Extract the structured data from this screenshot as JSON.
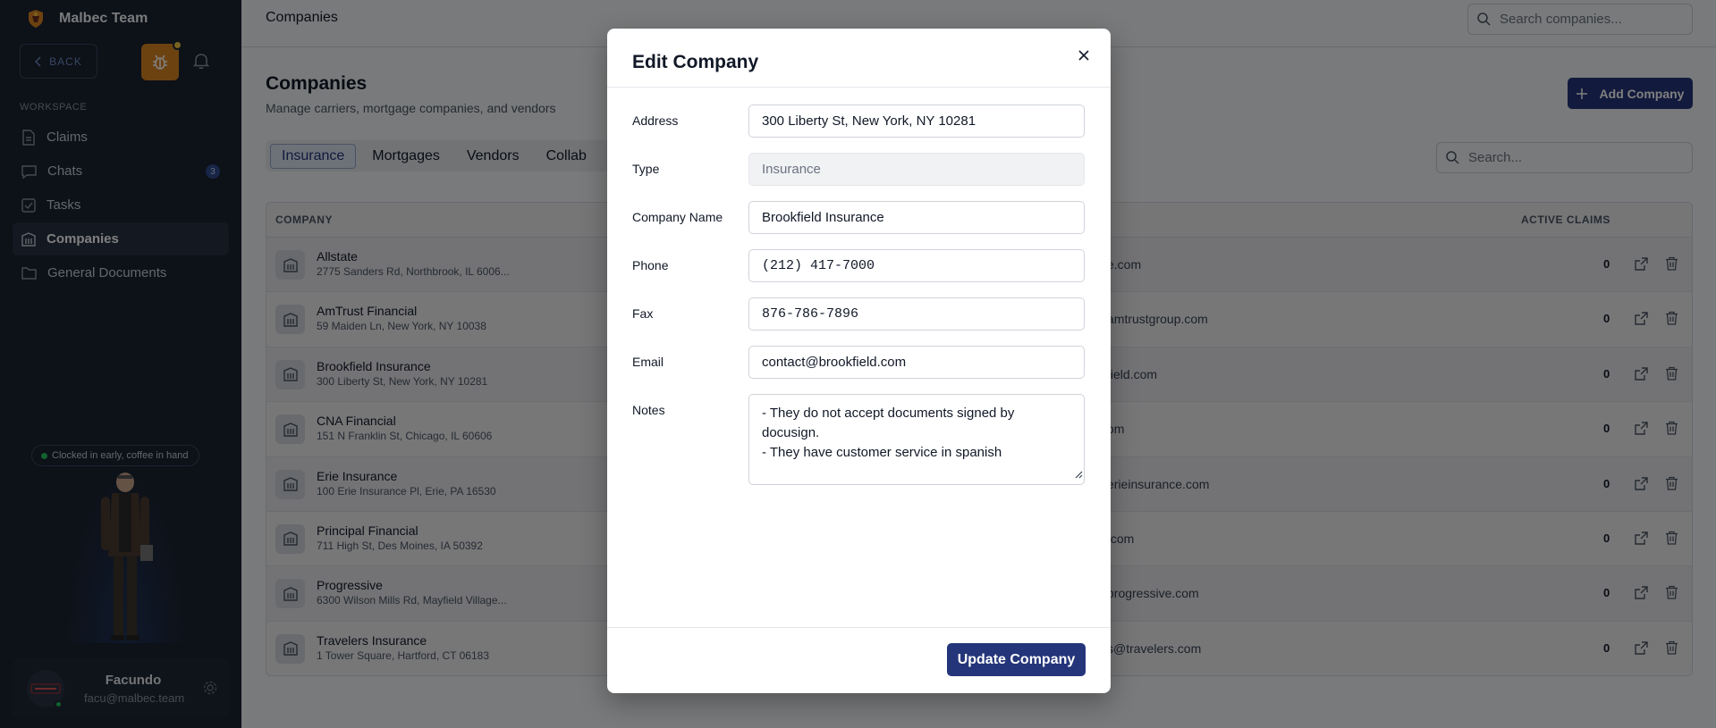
{
  "sidebar": {
    "brand": "Malbec Team",
    "back_label": "BACK",
    "section_label": "WORKSPACE",
    "nav": [
      {
        "label": "Claims",
        "icon": "file-icon"
      },
      {
        "label": "Chats",
        "icon": "chat-icon",
        "badge": "3"
      },
      {
        "label": "Tasks",
        "icon": "checkbox-icon"
      },
      {
        "label": "Companies",
        "icon": "building-icon",
        "active": true
      },
      {
        "label": "General Documents",
        "icon": "folder-icon"
      }
    ],
    "status": "Clocked in early, coffee in hand",
    "user": {
      "name": "Facundo",
      "email": "facu@malbec.team"
    }
  },
  "topbar": {
    "title": "Companies",
    "search_placeholder": "Search companies..."
  },
  "page": {
    "title": "Companies",
    "subtitle": "Manage carriers, mortgage companies, and vendors",
    "add_button": "Add Company",
    "tabs": [
      "Insurance",
      "Mortgages",
      "Vendors",
      "Collab"
    ],
    "active_tab": "Insurance",
    "search_placeholder": "Search..."
  },
  "table": {
    "headers": {
      "company": "COMPANY",
      "active_claims": "ACTIVE CLAIMS"
    },
    "rows": [
      {
        "name": "Allstate",
        "address": "2775 Sanders Rd, Northbrook, IL 6006...",
        "email": "e.com",
        "claims": "0"
      },
      {
        "name": "AmTrust Financial",
        "address": "59 Maiden Ln, New York, NY 10038",
        "email": "amtrustgroup.com",
        "claims": "0"
      },
      {
        "name": "Brookfield Insurance",
        "address": "300 Liberty St, New York, NY 10281",
        "email": "field.com",
        "claims": "0"
      },
      {
        "name": "CNA Financial",
        "address": "151 N Franklin St, Chicago, IL 60606",
        "email": "om",
        "claims": "0"
      },
      {
        "name": "Erie Insurance",
        "address": "100 Erie Insurance Pl, Erie, PA 16530",
        "email": "erieinsurance.com",
        "claims": "0"
      },
      {
        "name": "Principal Financial",
        "address": "711 High St, Des Moines, IA 50392",
        "email": ".com",
        "claims": "0"
      },
      {
        "name": "Progressive",
        "address": "6300 Wilson Mills Rd, Mayfield Village...",
        "email": "progressive.com",
        "claims": "0"
      },
      {
        "name": "Travelers Insurance",
        "address": "1 Tower Square, Hartford, CT 06183",
        "email": "s@travelers.com",
        "claims": "0"
      }
    ]
  },
  "modal": {
    "title": "Edit Company",
    "fields": {
      "address": {
        "label": "Address",
        "value": "300 Liberty St, New York, NY 10281"
      },
      "type": {
        "label": "Type",
        "value": "Insurance"
      },
      "company_name": {
        "label": "Company Name",
        "value": "Brookfield Insurance"
      },
      "phone": {
        "label": "Phone",
        "value": "(212) 417-7000"
      },
      "fax": {
        "label": "Fax",
        "value": "876-786-7896"
      },
      "email": {
        "label": "Email",
        "value": "contact@brookfield.com"
      },
      "notes": {
        "label": "Notes",
        "value": "- They do not accept documents signed by docusign.\n- They have customer service in spanish"
      }
    },
    "submit_label": "Update Company"
  },
  "colors": {
    "accent": "#24357a",
    "sidebar_bg": "#1b2331",
    "warning": "#d98522",
    "online": "#22c55e"
  }
}
